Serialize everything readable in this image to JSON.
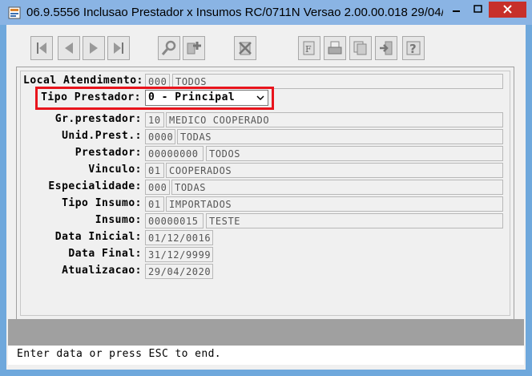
{
  "window": {
    "title": "06.9.5556 Inclusao  Prestador x Insumos RC/0711N Versao 2.00.00.018 29/04/..."
  },
  "toolbar": {
    "buttons": [
      {
        "name": "first-record-icon"
      },
      {
        "name": "previous-record-icon"
      },
      {
        "name": "next-record-icon"
      },
      {
        "name": "last-record-icon"
      },
      {
        "name": "search-icon"
      },
      {
        "name": "add-icon"
      },
      {
        "name": "cancel-icon"
      },
      {
        "name": "fields-icon"
      },
      {
        "name": "print-icon"
      },
      {
        "name": "copy-icon"
      },
      {
        "name": "exit-icon"
      },
      {
        "name": "help-icon"
      }
    ]
  },
  "form": {
    "local_atendimento": {
      "label": "Local Atendimento:",
      "code": "000",
      "desc": "TODOS"
    },
    "tipo_prestador": {
      "label": "Tipo Prestador:",
      "value": "0 - Principal"
    },
    "gr_prestador": {
      "label": "Gr.prestador:",
      "code": "10",
      "desc": "MEDICO COOPERADO"
    },
    "unid_prest": {
      "label": "Unid.Prest.:",
      "code": "0000",
      "desc": "TODAS"
    },
    "prestador": {
      "label": "Prestador:",
      "code": "00000000",
      "desc": "TODOS"
    },
    "vinculo": {
      "label": "Vinculo:",
      "code": "01",
      "desc": "COOPERADOS"
    },
    "especialidade": {
      "label": "Especialidade:",
      "code": "000",
      "desc": "TODAS"
    },
    "tipo_insumo": {
      "label": "Tipo Insumo:",
      "code": "01",
      "desc": "IMPORTADOS"
    },
    "insumo": {
      "label": "Insumo:",
      "code": "00000015",
      "desc": "TESTE"
    },
    "data_inicial": {
      "label": "Data Inicial:",
      "value": "01/12/0016"
    },
    "data_final": {
      "label": "Data Final:",
      "value": "31/12/9999"
    },
    "atualizacao": {
      "label": "Atualizacao:",
      "value": "29/04/2020"
    }
  },
  "status": {
    "message": "Enter data or press ESC to end."
  },
  "colors": {
    "highlight": "#e8141c",
    "close_button": "#c7302a",
    "title_bar": "#8ab4e4"
  }
}
